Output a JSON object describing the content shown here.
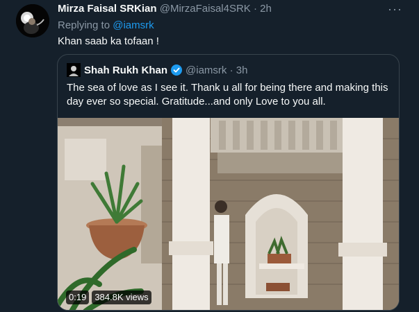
{
  "tweet": {
    "display_name": "Mirza Faisal SRKian",
    "handle_time": "@MirzaFaisal4SRK · 2h",
    "more_icon": "···",
    "replying_prefix": "Replying to ",
    "replying_handle": "@iamsrk",
    "text": "Khan saab ka tofaan !"
  },
  "quote": {
    "display_name": "Shah Rukh Khan",
    "handle_time": "@iamsrk · 3h",
    "text": "The sea of love as I see it. Thank u all for being there and making this day ever so special. Gratitude...and only Love to you all.",
    "video_duration": "0:19",
    "video_views": "384.8K views"
  },
  "colors": {
    "background": "#15202b",
    "link": "#1d9bf0",
    "verified": "#1d9bf0",
    "muted": "#8b98a5"
  }
}
